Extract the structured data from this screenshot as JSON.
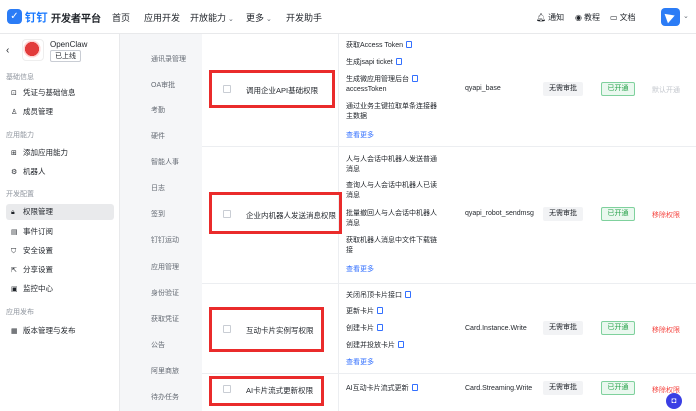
{
  "header": {
    "logo_text": "钉钉",
    "platform_title": "开发者平台",
    "nav": [
      {
        "label": "首页",
        "dropdown": false
      },
      {
        "label": "应用开发",
        "dropdown": false
      },
      {
        "label": "开放能力",
        "dropdown": true
      },
      {
        "label": "更多",
        "dropdown": true
      },
      {
        "label": "开发助手",
        "dropdown": false
      }
    ],
    "notify_label": "通知",
    "tutorial_label": "教程",
    "docs_label": "文档"
  },
  "app": {
    "name": "OpenClaw",
    "status": "已上线"
  },
  "sidebar": {
    "sections": [
      {
        "title": "基础信息",
        "items": [
          {
            "label": "凭证与基础信息",
            "icon": "credential-icon"
          },
          {
            "label": "成员管理",
            "icon": "member-icon"
          }
        ]
      },
      {
        "title": "应用能力",
        "items": [
          {
            "label": "添加应用能力",
            "icon": "grid-icon"
          },
          {
            "label": "机器人",
            "icon": "robot-icon"
          }
        ]
      },
      {
        "title": "开发配置",
        "items": [
          {
            "label": "权限管理",
            "icon": "lock-icon",
            "active": true
          },
          {
            "label": "事件订阅",
            "icon": "event-icon"
          },
          {
            "label": "安全设置",
            "icon": "shield-icon"
          },
          {
            "label": "分享设置",
            "icon": "share-icon"
          },
          {
            "label": "监控中心",
            "icon": "monitor-icon"
          }
        ]
      },
      {
        "title": "应用发布",
        "items": [
          {
            "label": "版本管理与发布",
            "icon": "version-icon"
          }
        ]
      }
    ]
  },
  "subnav": [
    "通讯录管理",
    "OA审批",
    "考勤",
    "硬件",
    "智能人事",
    "日志",
    "签到",
    "钉钉运动",
    "应用管理",
    "身份验证",
    "获取凭证",
    "公告",
    "阿里商旅",
    "待办任务"
  ],
  "permissions": [
    {
      "name": "调用企业API基础权限",
      "apis": [
        "获取Access Token",
        "生成jsapi ticket",
        "生成微应用管理后台accessToken",
        "通过业务主键拉取单条连接器主数据"
      ],
      "api_lines": [
        [
          "获取Access Token"
        ],
        [
          "生成jsapi ticket"
        ],
        [
          "生成微应用管理后台",
          "accessToken"
        ],
        [
          "通过业务主键拉取单条连接器",
          "主数据"
        ]
      ],
      "more": "查看更多",
      "code": "qyapi_base",
      "approval": "无需审批",
      "status": "已开通",
      "action": "默认开通",
      "action_type": "disabled"
    },
    {
      "name": "企业内机器人发送消息权限",
      "apis": [
        "人与人会话中机器人发送普通消息",
        "查询人与人会话中机器人已读消息",
        "批量撤回人与人会话中机器人消息",
        "获取机器人消息中文件下载链接"
      ],
      "api_lines": [
        [
          "人与人会话中机器人发送普通",
          "消息"
        ],
        [
          "查询人与人会话中机器人已读",
          "消息"
        ],
        [
          "批量撤回人与人会话中机器人",
          "消息"
        ],
        [
          "获取机器人消息中文件下载链",
          "接"
        ]
      ],
      "more": "查看更多",
      "code": "qyapi_robot_sendmsg",
      "approval": "无需审批",
      "status": "已开通",
      "action": "移除权限",
      "action_type": "danger"
    },
    {
      "name": "互动卡片实例写权限",
      "apis": [
        "关闭吊顶卡片接口",
        "更新卡片",
        "创建卡片",
        "创建并投放卡片"
      ],
      "api_lines": [
        [
          "关闭吊顶卡片接口"
        ],
        [
          "更新卡片"
        ],
        [
          "创建卡片"
        ],
        [
          "创建并投放卡片"
        ]
      ],
      "more": "查看更多",
      "code": "Card.Instance.Write",
      "approval": "无需审批",
      "status": "已开通",
      "action": "移除权限",
      "action_type": "danger"
    },
    {
      "name": "AI卡片流式更新权限",
      "apis": [
        "AI互动卡片流式更新"
      ],
      "api_lines": [
        [
          "AI互动卡片流式更新"
        ]
      ],
      "more": "",
      "code": "Card.Streaming.Write",
      "approval": "无需审批",
      "status": "已开通",
      "action": "移除权限",
      "action_type": "danger"
    }
  ],
  "colors": {
    "brand": "#1677ff",
    "link": "#3370ff",
    "highlight_box": "#ea2b2b",
    "enabled_green": "#24a148",
    "danger_red": "#f54a45"
  }
}
